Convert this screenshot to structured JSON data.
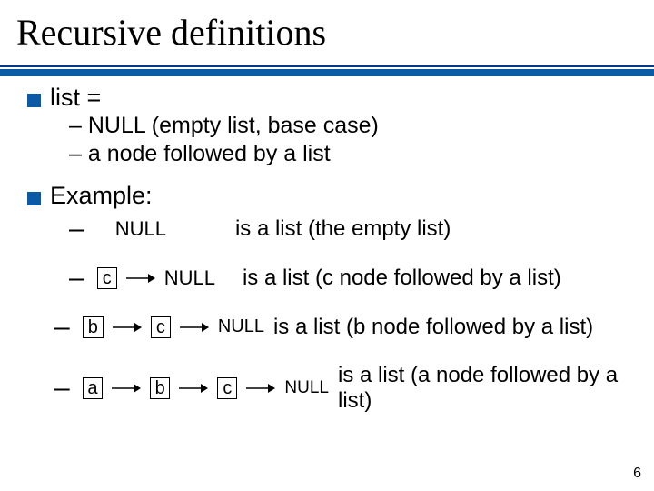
{
  "title": "Recursive definitions",
  "bullets": {
    "b1": "list =",
    "b2": "Example:"
  },
  "sub": {
    "s1": "– NULL (empty list, base case)",
    "s2": "– a node followed by a list"
  },
  "null_label": "NULL",
  "nodes": {
    "a": "a",
    "b": "b",
    "c": "c"
  },
  "desc": {
    "d1": "is a list (the empty list)",
    "d2": "is a list (c node followed by a list)",
    "d3": "is a list (b node followed by a list)",
    "d4": "is a list (a node followed by a list)"
  },
  "dash": "–",
  "page_number": "6"
}
